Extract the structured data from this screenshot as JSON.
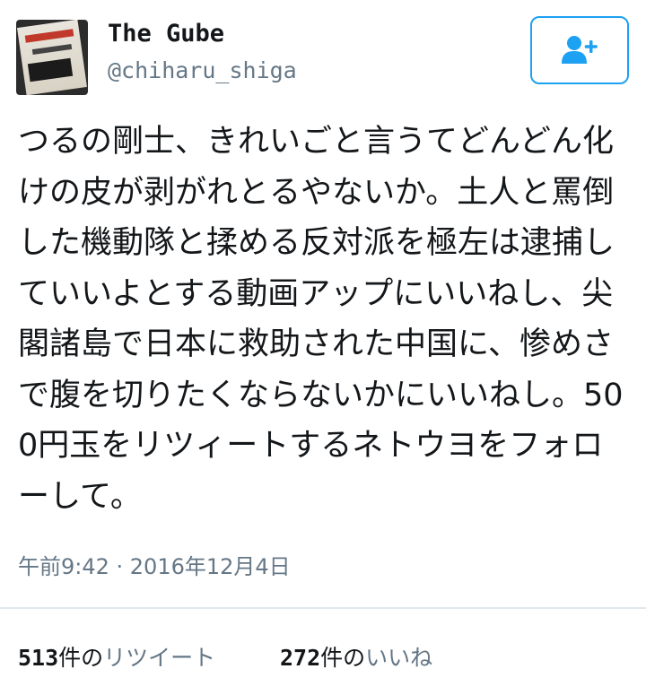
{
  "user": {
    "display_name": "The Gube",
    "handle": "@chiharu_shiga"
  },
  "follow_button": {
    "icon": "add-user-icon",
    "color": "#1da1f2"
  },
  "tweet": {
    "text": "つるの剛士、きれいごと言うてどんどん化けの皮が剥がれとるやないか。土人と罵倒した機動隊と揉める反対派を極左は逮捕していいよとする動画アップにいいねし、尖閣諸島で日本に救助された中国に、惨めさで腹を切りたくならないかにいいねし。500円玉をリツィートするネトウヨをフォローして。",
    "timestamp": "午前9:42 · 2016年12月4日"
  },
  "stats": {
    "retweets": {
      "count": "513",
      "unit": "件の",
      "label": "リツイート"
    },
    "likes": {
      "count": "272",
      "unit": "件の",
      "label": "いいね"
    }
  }
}
